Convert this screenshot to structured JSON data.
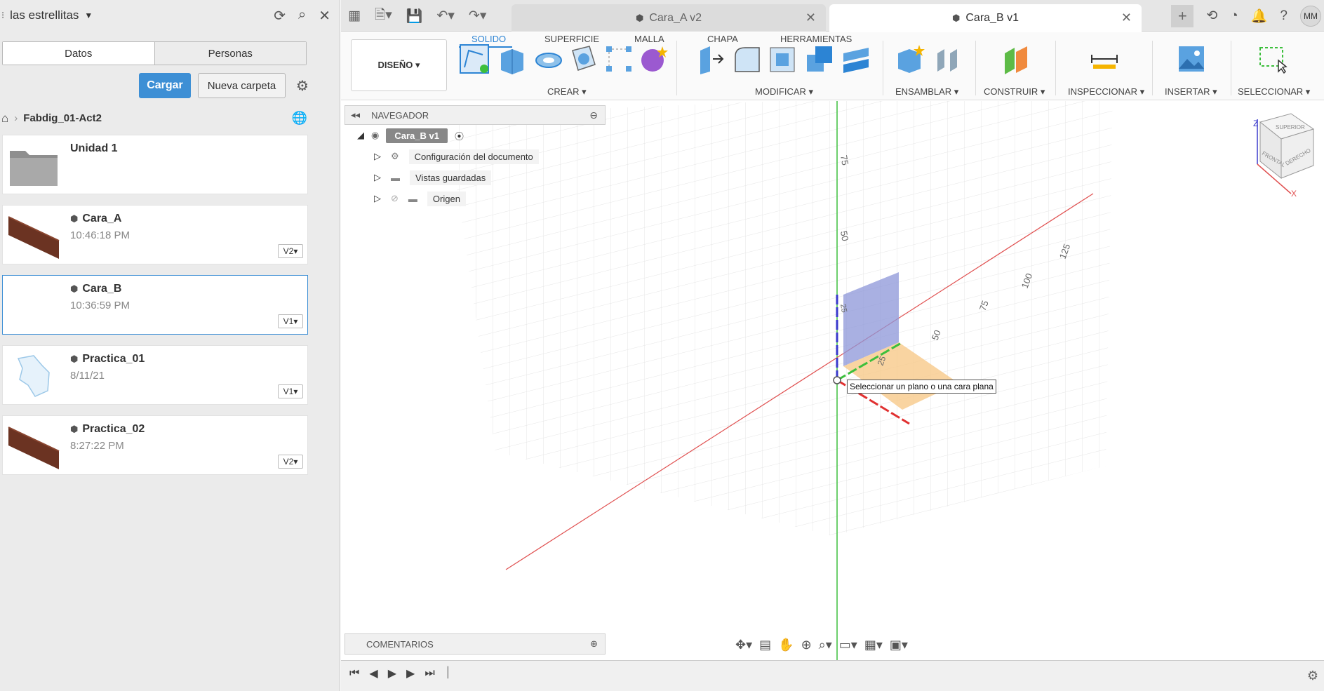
{
  "left_panel": {
    "team_name": "las estrellitas",
    "tabs": [
      "Datos",
      "Personas"
    ],
    "upload_label": "Cargar",
    "new_folder_label": "Nueva carpeta",
    "breadcrumb": "Fabdig_01-Act2",
    "files": [
      {
        "name": "Unidad 1",
        "date": "",
        "version": ""
      },
      {
        "name": "Cara_A",
        "date": "10:46:18 PM",
        "version": "V2▾"
      },
      {
        "name": "Cara_B",
        "date": "10:36:59 PM",
        "version": "V1▾"
      },
      {
        "name": "Practica_01",
        "date": "8/11/21",
        "version": "V1▾"
      },
      {
        "name": "Practica_02",
        "date": "8:27:22 PM",
        "version": "V2▾"
      }
    ]
  },
  "doc_tabs": [
    "Cara_A v2",
    "Cara_B v1"
  ],
  "user_initials": "MM",
  "toolbar": {
    "workspace": "DISEÑO ▾",
    "tabs": [
      "SOLIDO",
      "SUPERFICIE",
      "MALLA",
      "CHAPA",
      "HERRAMIENTAS"
    ],
    "groups": [
      "CREAR ▾",
      "MODIFICAR ▾",
      "ENSAMBLAR ▾",
      "CONSTRUIR ▾",
      "INSPECCIONAR ▾",
      "INSERTAR ▾",
      "SELECCIONAR ▾"
    ]
  },
  "navigator": {
    "title": "NAVEGADOR",
    "root": "Cara_B v1",
    "items": [
      "Configuración del documento",
      "Vistas guardadas",
      "Origen"
    ]
  },
  "comments_label": "COMENTARIOS",
  "tooltip": "Seleccionar un plano o una cara plana",
  "axis_labels": [
    "75",
    "50",
    "25",
    "125",
    "100",
    "75",
    "50",
    "25"
  ],
  "viewcube": {
    "top": "SUPERIOR",
    "front": "FRONTAL",
    "right": "DERECHO",
    "z": "Z",
    "x": "X"
  },
  "colors": {
    "accent": "#2c84d4",
    "axis_x": "#e05050",
    "axis_y": "#3cbf3c",
    "axis_z": "#3a3acc"
  }
}
